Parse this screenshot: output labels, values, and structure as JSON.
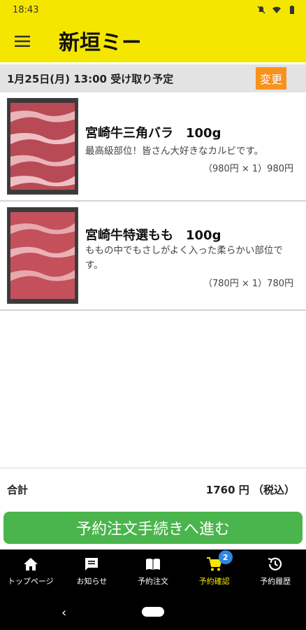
{
  "status_bar": {
    "time": "18:43"
  },
  "header": {
    "logo_text": "新垣ミート"
  },
  "pickup": {
    "text": "1月25日(月) 13:00 受け取り予定",
    "change_label": "変更"
  },
  "items": [
    {
      "title": "宮崎牛三角バラ　100g",
      "description": "最高級部位！皆さん大好きなカルビです。",
      "price": "（980円 × 1）980円"
    },
    {
      "title": "宮崎牛特選もも　100g",
      "description": "ももの中でもさしがよく入った柔らかい部位です。",
      "price": "（780円 × 1）780円"
    }
  ],
  "total": {
    "label": "合計",
    "value": "1760 円 （税込）"
  },
  "proceed_label": "予約注文手続きへ進む",
  "bottom_nav": [
    {
      "label": "トップページ",
      "icon": "home-icon"
    },
    {
      "label": "お知らせ",
      "icon": "message-icon"
    },
    {
      "label": "予約注文",
      "icon": "book-icon"
    },
    {
      "label": "予約確認",
      "icon": "cart-icon",
      "badge": "2",
      "active": true
    },
    {
      "label": "予約履歴",
      "icon": "history-icon"
    }
  ],
  "colors": {
    "brand_yellow": "#f5e600",
    "accent_orange": "#f7921e",
    "proceed_green": "#4ab54c",
    "badge_blue": "#2e86de"
  }
}
